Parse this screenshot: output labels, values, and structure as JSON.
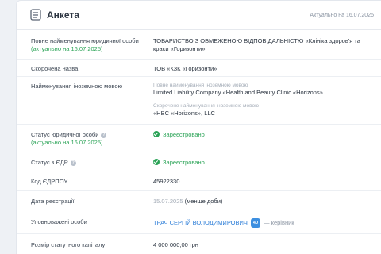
{
  "header": {
    "title": "Анкета",
    "actual_date": "Актуально на 16.07.2025",
    "icon": "document-icon"
  },
  "rows": {
    "full_name": {
      "label": "Повне найменування юридичної особи",
      "actual": "(актуально на 16.07.2025)",
      "value": "ТОВАРИСТВО З ОБМЕЖЕНОЮ ВІДПОВІДАЛЬНІСТЮ «Клініка здоров'я та краси «Горизонти»"
    },
    "short_name": {
      "label": "Скорочена назва",
      "value": "ТОВ «КЗК «Горизонти»"
    },
    "foreign_name": {
      "label": "Найменування іноземною мовою",
      "full_caption": "Повне найменування іноземною мовою",
      "full_value": "Limited Liability Company «Health and Beauty Clinic «Horizons»",
      "short_caption": "Скорочене найменування іноземною мовою",
      "short_value": "«HBC «Horizons», LLC"
    },
    "legal_status": {
      "label": "Статус юридичної особи",
      "actual": "(актуально на 16.07.2025)",
      "value": "Зареєстровано"
    },
    "edr_status": {
      "label": "Статус з ЄДР",
      "value": "Зареєстровано"
    },
    "edrpou": {
      "label": "Код ЄДРПОУ",
      "value": "45922330"
    },
    "reg_date": {
      "label": "Дата реєстрації",
      "date": "15.07.2025",
      "note": "(менше доби)"
    },
    "authorized": {
      "label": "Уповноважені особи",
      "name": "ТРАЧ СЕРГІЙ ВОЛОДИМИРОВИЧ",
      "badge": "40",
      "role": "— керівник"
    },
    "capital": {
      "label": "Розмір статутного капіталу",
      "value": "4 000 000,00 грн"
    }
  },
  "colors": {
    "accent": "#2f7fd8",
    "success": "#2aa356",
    "muted": "#a4acb7"
  }
}
